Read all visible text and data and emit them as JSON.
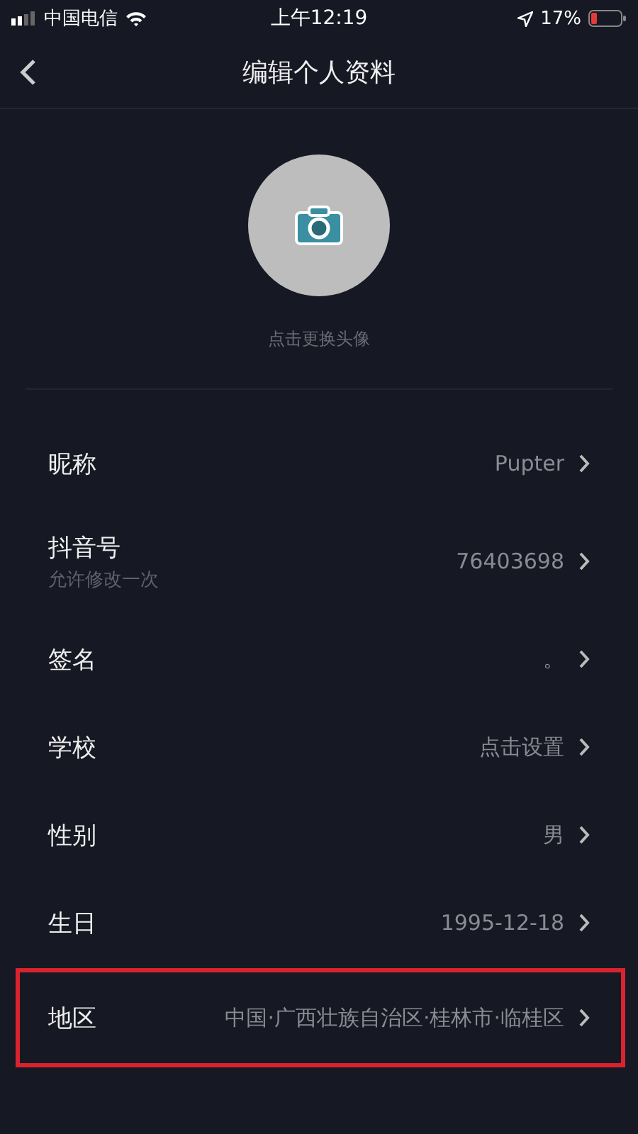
{
  "status_bar": {
    "carrier": "中国电信",
    "time": "上午12:19",
    "battery": "17%"
  },
  "nav": {
    "title": "编辑个人资料"
  },
  "avatar": {
    "caption": "点击更换头像"
  },
  "fields": [
    {
      "label": "昵称",
      "value": "Pupter",
      "highlighted": false
    },
    {
      "label": "抖音号",
      "hint": "允许修改一次",
      "value": "76403698",
      "highlighted": false
    },
    {
      "label": "签名",
      "value": "。",
      "highlighted": false
    },
    {
      "label": "学校",
      "value": "点击设置",
      "highlighted": false
    },
    {
      "label": "性别",
      "value": "男",
      "highlighted": false
    },
    {
      "label": "生日",
      "value": "1995-12-18",
      "highlighted": false
    },
    {
      "label": "地区",
      "value": "中国·广西壮族自治区·桂林市·临桂区",
      "highlighted": true
    }
  ]
}
